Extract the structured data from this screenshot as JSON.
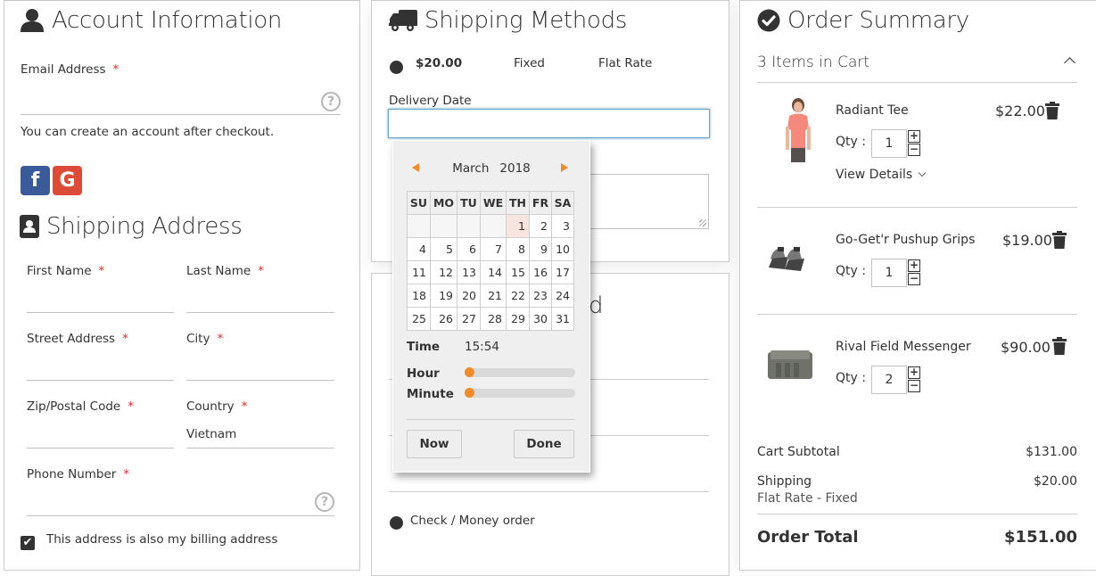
{
  "account": {
    "title": "Account Information",
    "email_label": "Email Address",
    "email_value": "",
    "required_mark": "*",
    "help": "?",
    "note": "You can create an account after checkout.",
    "social": [
      {
        "name": "facebook",
        "glyph": "f",
        "color": "#3b5a9a"
      },
      {
        "name": "google",
        "glyph": "G",
        "color": "#dc4a38"
      }
    ]
  },
  "shipping_address": {
    "title": "Shipping Address",
    "fields": {
      "first_name": {
        "label": "First Name",
        "value": ""
      },
      "last_name": {
        "label": "Last Name",
        "value": ""
      },
      "street": {
        "label": "Street Address",
        "value": ""
      },
      "city": {
        "label": "City",
        "value": ""
      },
      "zip": {
        "label": "Zip/Postal Code",
        "value": ""
      },
      "country": {
        "label": "Country",
        "value": "Vietnam"
      },
      "phone": {
        "label": "Phone Number",
        "value": ""
      }
    },
    "billing_same": {
      "label": "This address is also my billing address",
      "checked": true
    }
  },
  "shipping_methods": {
    "title": "Shipping Methods",
    "options": [
      {
        "price": "$20.00",
        "method": "Fixed",
        "carrier": "Flat Rate",
        "selected": true
      }
    ],
    "delivery_date_label": "Delivery Date",
    "delivery_date_value": ""
  },
  "datepicker": {
    "month": "March",
    "year": "2018",
    "weekdays": [
      "SU",
      "MO",
      "TU",
      "WE",
      "TH",
      "FR",
      "SA"
    ],
    "weeks": [
      [
        "",
        "",
        "",
        "",
        "1",
        "2",
        "3"
      ],
      [
        "4",
        "5",
        "6",
        "7",
        "8",
        "9",
        "10"
      ],
      [
        "11",
        "12",
        "13",
        "14",
        "15",
        "16",
        "17"
      ],
      [
        "18",
        "19",
        "20",
        "21",
        "22",
        "23",
        "24"
      ],
      [
        "25",
        "26",
        "27",
        "28",
        "29",
        "30",
        "31"
      ]
    ],
    "highlighted_day": "1",
    "time_label": "Time",
    "time_value": "15:54",
    "hour_label": "Hour",
    "minute_label": "Minute",
    "hour_fraction": 0,
    "minute_fraction": 0,
    "now_label": "Now",
    "done_label": "Done",
    "accent": "#f08c2c"
  },
  "payment": {
    "title_fragment": "d",
    "options": [
      {
        "label": "Check / Money order",
        "selected": true
      }
    ]
  },
  "order_summary": {
    "title": "Order Summary",
    "items_in_cart": "3 Items in Cart",
    "qty_label": "Qty :",
    "view_details": "View Details",
    "items": [
      {
        "name": "Radiant Tee",
        "price": "$22.00",
        "qty": "1"
      },
      {
        "name": "Go-Get'r Pushup Grips",
        "price": "$19.00",
        "qty": "1"
      },
      {
        "name": "Rival Field Messenger",
        "price": "$90.00",
        "qty": "2"
      }
    ],
    "totals": {
      "subtotal_label": "Cart Subtotal",
      "subtotal_value": "$131.00",
      "shipping_label": "Shipping",
      "shipping_value": "$20.00",
      "shipping_method": "Flat Rate - Fixed",
      "order_total_label": "Order Total",
      "order_total_value": "$151.00"
    }
  }
}
